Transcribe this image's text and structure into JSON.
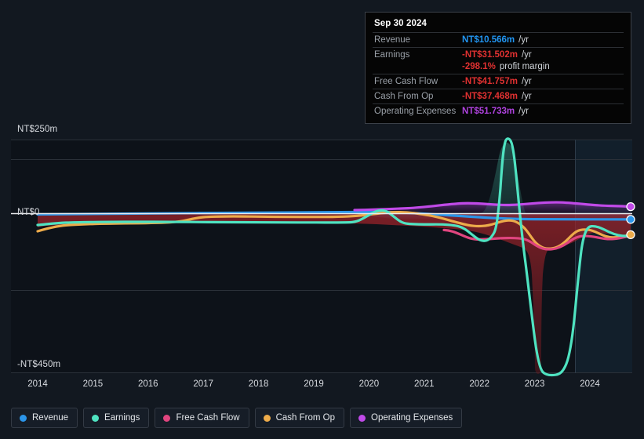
{
  "tooltip": {
    "date": "Sep 30 2024",
    "rows": [
      {
        "key": "Revenue",
        "value": "NT$10.566m",
        "suffix": "/yr",
        "color": "#2196f3"
      },
      {
        "key": "Earnings",
        "value": "-NT$31.502m",
        "suffix": "/yr",
        "color": "#e03131"
      },
      {
        "key": "",
        "value": "-298.1%",
        "suffix": "profit margin",
        "color": "#e03131",
        "sub": true
      },
      {
        "key": "Free Cash Flow",
        "value": "-NT$41.757m",
        "suffix": "/yr",
        "color": "#e03131"
      },
      {
        "key": "Cash From Op",
        "value": "-NT$37.468m",
        "suffix": "/yr",
        "color": "#e03131"
      },
      {
        "key": "Operating Expenses",
        "value": "NT$51.733m",
        "suffix": "/yr",
        "color": "#b043e0"
      }
    ]
  },
  "legend": {
    "items": [
      {
        "label": "Revenue",
        "color": "#2b95e9"
      },
      {
        "label": "Earnings",
        "color": "#4fe3c1"
      },
      {
        "label": "Free Cash Flow",
        "color": "#e0457f"
      },
      {
        "label": "Cash From Op",
        "color": "#edab4a"
      },
      {
        "label": "Operating Expenses",
        "color": "#c04ae8"
      }
    ]
  },
  "axes": {
    "y_top_label": "NT$250m",
    "y_zero_label": "NT$0",
    "y_bottom_label": "-NT$450m",
    "x_labels": [
      "2014",
      "2015",
      "2016",
      "2017",
      "2018",
      "2019",
      "2020",
      "2021",
      "2022",
      "2023",
      "2024"
    ]
  },
  "chart_data": {
    "type": "line",
    "title": "",
    "xlabel": "",
    "ylabel": "NT$ (millions)",
    "ylim": [
      -450,
      250
    ],
    "xlim": [
      2014,
      2024.8
    ],
    "grid": true,
    "legend_position": "bottom",
    "currency": "NT$",
    "units": "millions",
    "x": [
      2014,
      2014.5,
      2015,
      2015.5,
      2016,
      2016.5,
      2017,
      2017.5,
      2018,
      2018.5,
      2019,
      2019.5,
      2020,
      2020.5,
      2021,
      2021.5,
      2022,
      2022.3,
      2022.6,
      2022.9,
      2023.1,
      2023.4,
      2023.7,
      2024,
      2024.3,
      2024.6,
      2024.8
    ],
    "series": [
      {
        "name": "Revenue",
        "color": "#2b95e9",
        "values": [
          2,
          3,
          4,
          5,
          6,
          6,
          7,
          7,
          8,
          8,
          9,
          9,
          10,
          11,
          12,
          12,
          12,
          12,
          12,
          11,
          11,
          11,
          11,
          11,
          11,
          10.566,
          10.566
        ]
      },
      {
        "name": "Earnings",
        "color": "#4fe3c1",
        "values": [
          -8,
          -8,
          -9,
          -9,
          -10,
          -10,
          -11,
          -11,
          -12,
          -12,
          -10,
          8,
          -6,
          -12,
          -14,
          -18,
          60,
          200,
          250,
          60,
          -300,
          -440,
          -445,
          -330,
          -40,
          -31.502,
          -31.502
        ]
      },
      {
        "name": "Free Cash Flow",
        "color": "#e0457f",
        "values": [
          null,
          null,
          null,
          null,
          null,
          null,
          null,
          null,
          null,
          null,
          null,
          null,
          null,
          null,
          -20,
          -25,
          -30,
          -32,
          -32,
          -33,
          -34,
          -48,
          -52,
          -38,
          -42,
          -41.757,
          -41.757
        ]
      },
      {
        "name": "Cash From Op",
        "color": "#edab4a",
        "values": [
          -30,
          -26,
          -20,
          -19,
          -18,
          -17,
          -6,
          -5,
          -4,
          -4,
          -5,
          -6,
          -4,
          -7,
          -12,
          -16,
          -18,
          -30,
          -24,
          -22,
          -40,
          -44,
          -20,
          -13,
          -30,
          -37.468,
          -37.468
        ]
      },
      {
        "name": "Operating Expenses",
        "color": "#c04ae8",
        "values": [
          null,
          null,
          null,
          null,
          null,
          null,
          null,
          null,
          null,
          null,
          null,
          null,
          16,
          16,
          17,
          18,
          24,
          26,
          28,
          26,
          26,
          30,
          29,
          28,
          30,
          51.733,
          51.733
        ]
      }
    ],
    "annotations": {
      "forecast_region_start": 2023.95,
      "earnings_peak": {
        "x": 2022.6,
        "y": 250
      },
      "earnings_trough": {
        "x": 2023.45,
        "y": -445
      }
    }
  }
}
